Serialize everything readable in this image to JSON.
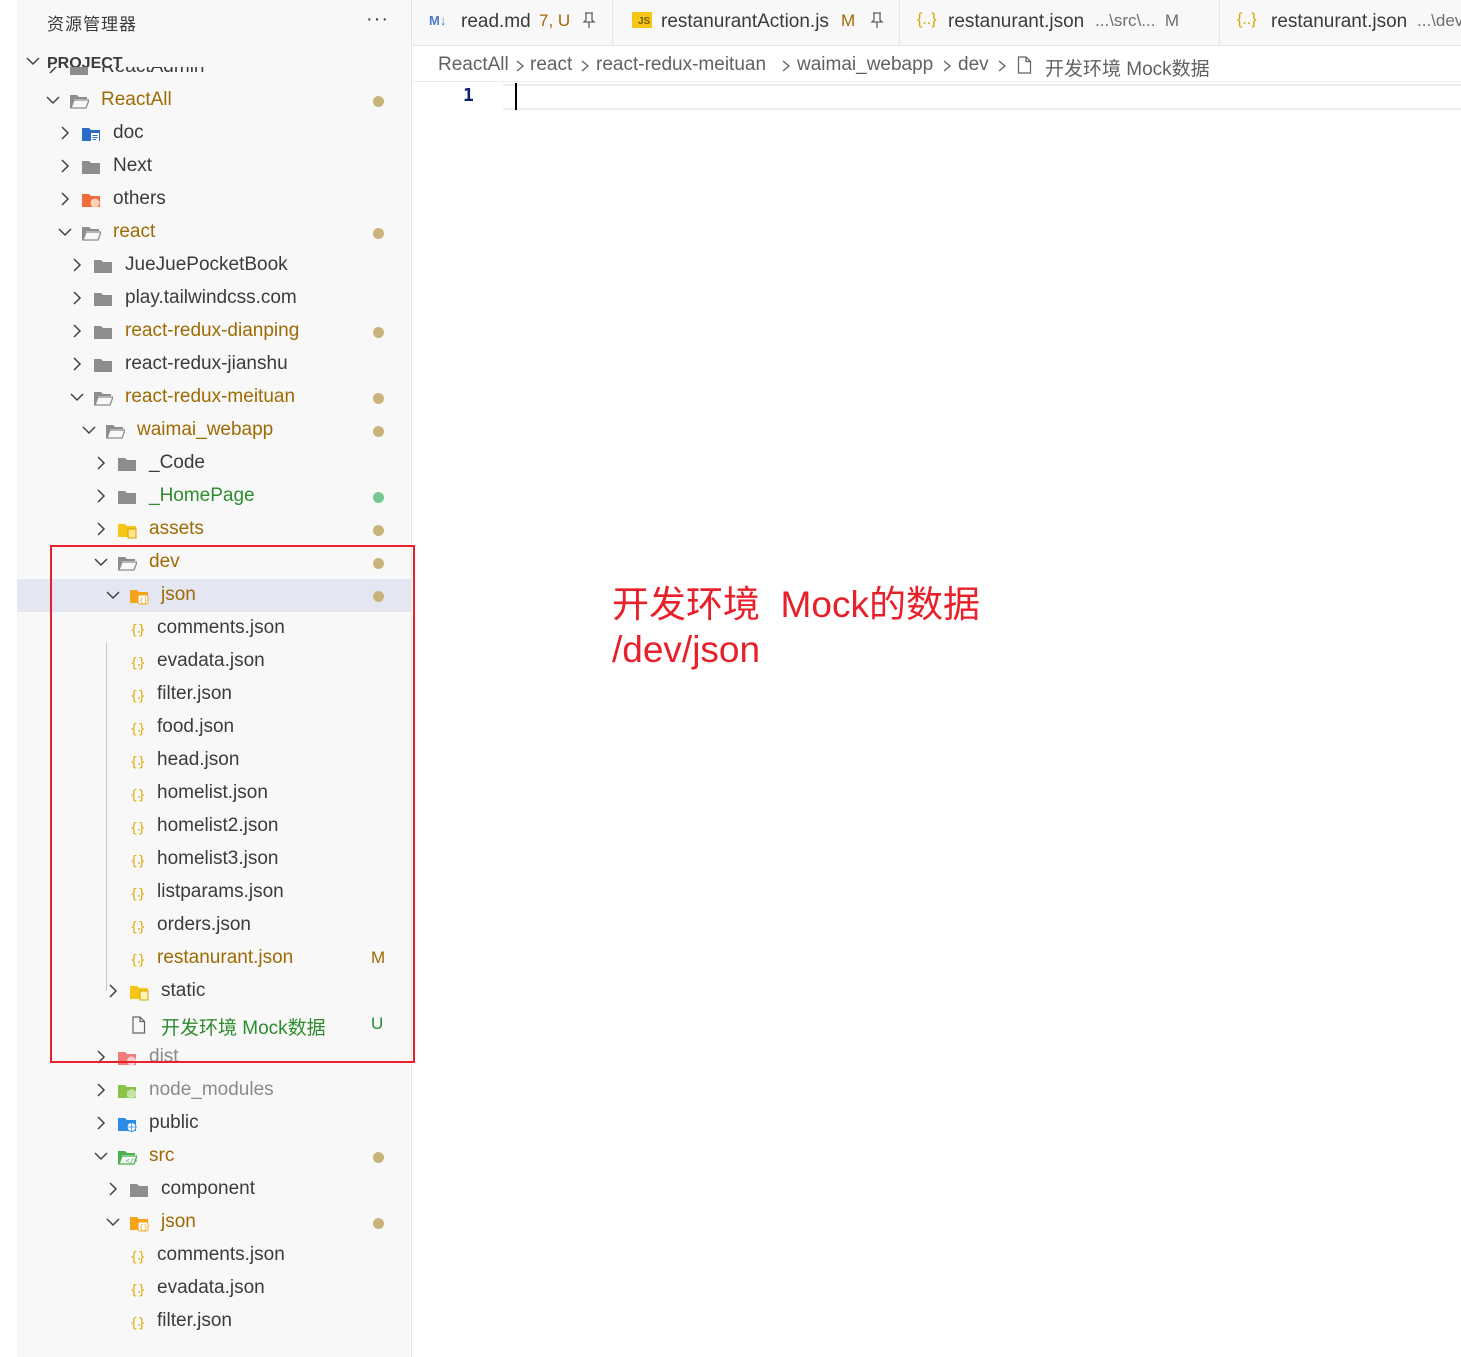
{
  "sidebar": {
    "title": "资源管理器",
    "more": "···",
    "project_label": "PROJECT"
  },
  "tree": {
    "rows": [
      {
        "label": "ReactAdmin",
        "badge": ""
      },
      {
        "label": "ReactAll",
        "badge": ""
      },
      {
        "label": "doc",
        "badge": ""
      },
      {
        "label": "Next",
        "badge": ""
      },
      {
        "label": "others",
        "badge": ""
      },
      {
        "label": "react",
        "badge": ""
      },
      {
        "label": "JueJuePocketBook",
        "badge": ""
      },
      {
        "label": "play.tailwindcss.com",
        "badge": ""
      },
      {
        "label": "react-redux-dianping",
        "badge": ""
      },
      {
        "label": "react-redux-jianshu",
        "badge": ""
      },
      {
        "label": "react-redux-meituan",
        "badge": ""
      },
      {
        "label": "waimai_webapp",
        "badge": ""
      },
      {
        "label": "_Code",
        "badge": ""
      },
      {
        "label": "_HomePage",
        "badge": ""
      },
      {
        "label": "assets",
        "badge": ""
      },
      {
        "label": "dev",
        "badge": ""
      },
      {
        "label": "json",
        "badge": ""
      },
      {
        "label": "comments.json",
        "badge": ""
      },
      {
        "label": "evadata.json",
        "badge": ""
      },
      {
        "label": "filter.json",
        "badge": ""
      },
      {
        "label": "food.json",
        "badge": ""
      },
      {
        "label": "head.json",
        "badge": ""
      },
      {
        "label": "homelist.json",
        "badge": ""
      },
      {
        "label": "homelist2.json",
        "badge": ""
      },
      {
        "label": "homelist3.json",
        "badge": ""
      },
      {
        "label": "listparams.json",
        "badge": ""
      },
      {
        "label": "orders.json",
        "badge": ""
      },
      {
        "label": "restanurant.json",
        "badge": "M"
      },
      {
        "label": "static",
        "badge": ""
      },
      {
        "label": "开发环境 Mock数据",
        "badge": "U"
      },
      {
        "label": "dist",
        "badge": ""
      },
      {
        "label": "node_modules",
        "badge": ""
      },
      {
        "label": "public",
        "badge": ""
      },
      {
        "label": "src",
        "badge": ""
      },
      {
        "label": "component",
        "badge": ""
      },
      {
        "label": "json",
        "badge": ""
      },
      {
        "label": "comments.json",
        "badge": ""
      },
      {
        "label": "evadata.json",
        "badge": ""
      },
      {
        "label": "filter.json",
        "badge": ""
      }
    ]
  },
  "tabs": [
    {
      "icon": "M↓",
      "label": "read.md",
      "extra": "7, U"
    },
    {
      "icon": "JS",
      "label": "restanurantAction.js",
      "extra": "M"
    },
    {
      "icon": "{..}",
      "label": "restanurant.json",
      "extra": "...\\src\\...  M"
    },
    {
      "icon": "{..}",
      "label": "restanurant.json",
      "extra": "...\\dev"
    }
  ],
  "breadcrumb": [
    "ReactAll",
    "react",
    "react-redux-meituan",
    "waimai_webapp",
    "dev",
    "开发环境 Mock数据"
  ],
  "editor": {
    "line_number": "1"
  },
  "annotation": {
    "line1": "开发环境  Mock的数据",
    "line2": "/dev/json"
  },
  "colors": {
    "modified": "#9e6a03",
    "untracked": "#2e8b2e",
    "annotation": "#e8202a",
    "selected_row": "#e4e6f1"
  }
}
